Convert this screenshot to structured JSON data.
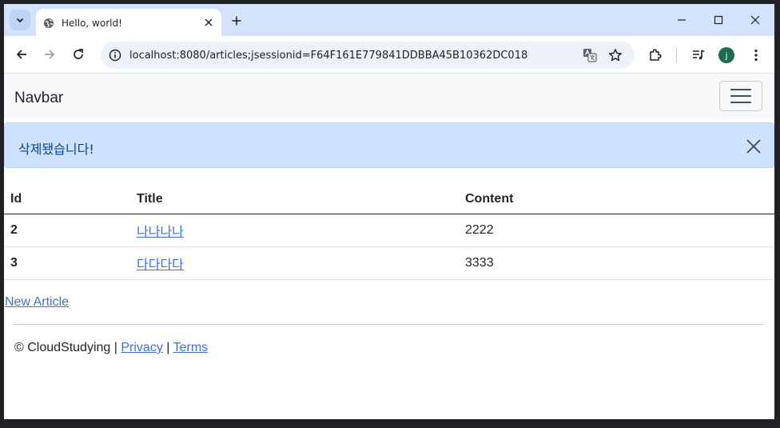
{
  "browser": {
    "tab": {
      "title": "Hello, world!"
    },
    "address": {
      "url": "localhost:8080/articles;jsessionid=F64F161E779841DDBBA45B10362DC018"
    },
    "profile_initial": "j"
  },
  "navbar": {
    "brand": "Navbar"
  },
  "alert": {
    "message": "삭제됐습니다!"
  },
  "table": {
    "headers": [
      "Id",
      "Title",
      "Content"
    ],
    "rows": [
      {
        "id": "2",
        "title": "나나나나",
        "content": "2222"
      },
      {
        "id": "3",
        "title": "다다다다",
        "content": "3333"
      }
    ]
  },
  "new_article_link": "New Article",
  "footer": {
    "copyright": "© CloudStudying",
    "separator": "|",
    "privacy": "Privacy",
    "terms": "Terms"
  },
  "colors": {
    "tabstrip": "#d3e3fd",
    "alert_bg": "#cfe2ff",
    "alert_text": "#084298",
    "link": "#3d6fd9",
    "avatar": "#1e6b52"
  }
}
